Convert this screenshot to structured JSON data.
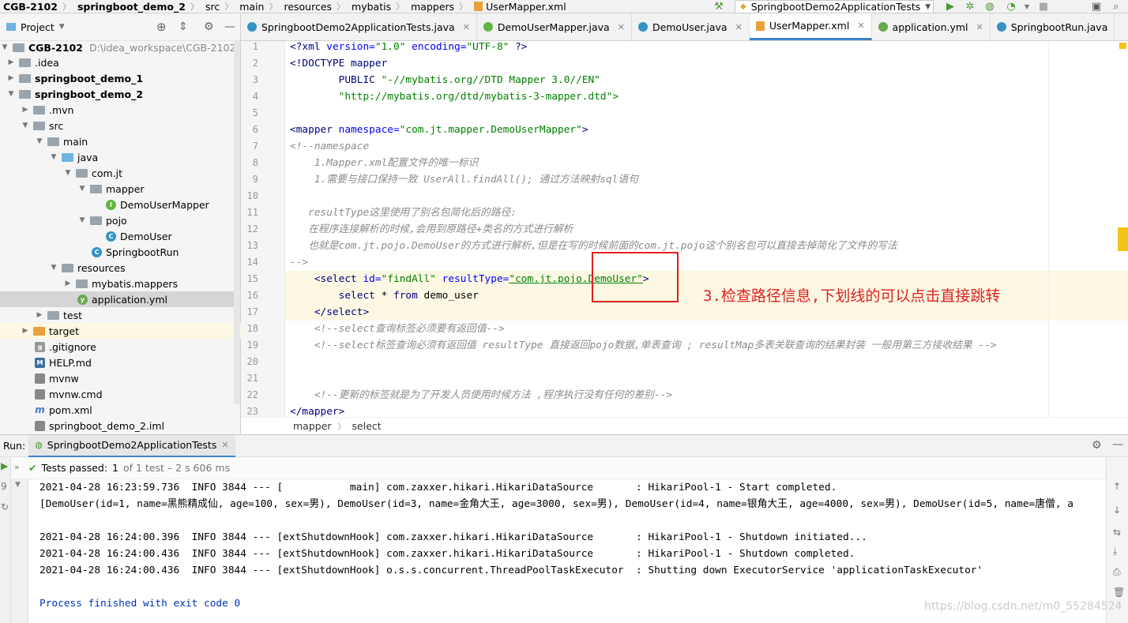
{
  "navbar": {
    "crumbs": [
      "CGB-2102",
      "springboot_demo_2",
      "src",
      "main",
      "resources",
      "mybatis",
      "mappers",
      "UserMapper.xml"
    ],
    "run_config": "SpringbootDemo2ApplicationTests"
  },
  "project": {
    "title": "Project",
    "root_name": "CGB-2102",
    "root_path": "D:\\idea_workspace\\CGB-2102",
    "items": [
      {
        "label": ".idea"
      },
      {
        "label": "springboot_demo_1"
      },
      {
        "label": "springboot_demo_2"
      },
      {
        "label": ".mvn"
      },
      {
        "label": "src"
      },
      {
        "label": "main"
      },
      {
        "label": "java"
      },
      {
        "label": "com.jt"
      },
      {
        "label": "mapper"
      },
      {
        "label": "DemoUserMapper"
      },
      {
        "label": "pojo"
      },
      {
        "label": "DemoUser"
      },
      {
        "label": "SpringbootRun"
      },
      {
        "label": "resources"
      },
      {
        "label": "mybatis.mappers"
      },
      {
        "label": "application.yml"
      },
      {
        "label": "test"
      },
      {
        "label": "target"
      },
      {
        "label": ".gitignore"
      },
      {
        "label": "HELP.md"
      },
      {
        "label": "mvnw"
      },
      {
        "label": "mvnw.cmd"
      },
      {
        "label": "pom.xml"
      },
      {
        "label": "springboot_demo_2.iml"
      }
    ]
  },
  "tabs": [
    {
      "label": "SpringbootDemo2ApplicationTests.java"
    },
    {
      "label": "DemoUserMapper.java"
    },
    {
      "label": "DemoUser.java"
    },
    {
      "label": "UserMapper.xml"
    },
    {
      "label": "application.yml"
    },
    {
      "label": "SpringbootRun.java"
    }
  ],
  "editor": {
    "line_numbers": [
      "1",
      "2",
      "3",
      "4",
      "5",
      "6",
      "7",
      "8",
      "9",
      "10",
      "11",
      "12",
      "13",
      "14",
      "15",
      "16",
      "17",
      "18",
      "19",
      "20",
      "21",
      "22",
      "23"
    ],
    "l1": {
      "a": "<?xml ",
      "b": "version=",
      "c": "\"1.0\" ",
      "d": "encoding=",
      "e": "\"UTF-8\" ",
      "f": "?>"
    },
    "l2": "<!DOCTYPE mapper",
    "l3": {
      "a": "        PUBLIC ",
      "b": "\"-//mybatis.org//DTD Mapper 3.0//EN\""
    },
    "l4": "        \"http://mybatis.org/dtd/mybatis-3-mapper.dtd\">",
    "l6": {
      "a": "<mapper ",
      "b": "namespace=",
      "c": "\"com.jt.mapper.DemoUserMapper\"",
      "d": ">"
    },
    "l7": "<!--namespace",
    "l8": "    1.Mapper.xml配置文件的唯一标识",
    "l9": "    1.需要与接口保持一致 UserAll.findAll(); 通过方法映射sql语句",
    "l11": "   resultType这里使用了别名包简化后的路径:",
    "l12": "   在程序连接解析的时候,会用到原路径+类名的方式进行解析",
    "l13": "   也就是com.jt.pojo.DemoUser的方式进行解析,但是在写的时候前面的com.jt.pojo这个别名包可以直接去掉简化了文件的写法",
    "l14": "-->",
    "l15": {
      "a": "    <select ",
      "b": "id=",
      "c": "\"findAll\" ",
      "d": "resultType=",
      "e": "\"com.jt.pojo.DemoUser\"",
      "f": ">"
    },
    "l16": {
      "a": "        select ",
      "b": "* ",
      "c": "from ",
      "d": "demo_user"
    },
    "l17": "    </select>",
    "l18": "    <!--select查询标签必须要有返回值-->",
    "l19": "    <!--select标签查询必须有返回值 resultType 直接返回pojo数据,单表查询 ; resultMap多表关联查询的结果封装 一般用第三方接收结果 -->",
    "l22": "    <!--更新的标签就是为了开发人员使用时候方法 ,程序执行没有任何的差别-->",
    "l23": "</mapper>",
    "annotation": "3.检查路径信息,下划线的可以点击直接跳转"
  },
  "editor_crumb": [
    "mapper",
    "select"
  ],
  "run": {
    "label": "Run:",
    "tab": "SpringbootDemo2ApplicationTests",
    "status_bold": "Tests passed:",
    "status_count": "1",
    "status_rest": "of 1 test – 2 s 606 ms",
    "console": [
      "2021-04-28 16:23:59.736  INFO 3844 --- [           main] com.zaxxer.hikari.HikariDataSource       : HikariPool-1 - Start completed.",
      "[DemoUser(id=1, name=黑熊精成仙, age=100, sex=男), DemoUser(id=3, name=金角大王, age=3000, sex=男), DemoUser(id=4, name=银角大王, age=4000, sex=男), DemoUser(id=5, name=唐僧, a",
      "",
      "2021-04-28 16:24:00.396  INFO 3844 --- [extShutdownHook] com.zaxxer.hikari.HikariDataSource       : HikariPool-1 - Shutdown initiated...",
      "2021-04-28 16:24:00.436  INFO 3844 --- [extShutdownHook] com.zaxxer.hikari.HikariDataSource       : HikariPool-1 - Shutdown completed.",
      "2021-04-28 16:24:00.436  INFO 3844 --- [extShutdownHook] o.s.s.concurrent.ThreadPoolTaskExecutor  : Shutting down ExecutorService 'applicationTaskExecutor'",
      "",
      "Process finished with exit code 0"
    ]
  },
  "watermark": "https://blog.csdn.net/m0_55284524",
  "colors": {
    "accent": "#4083c9",
    "annotation": "#e02020",
    "highlight": "#fcf8e3"
  }
}
